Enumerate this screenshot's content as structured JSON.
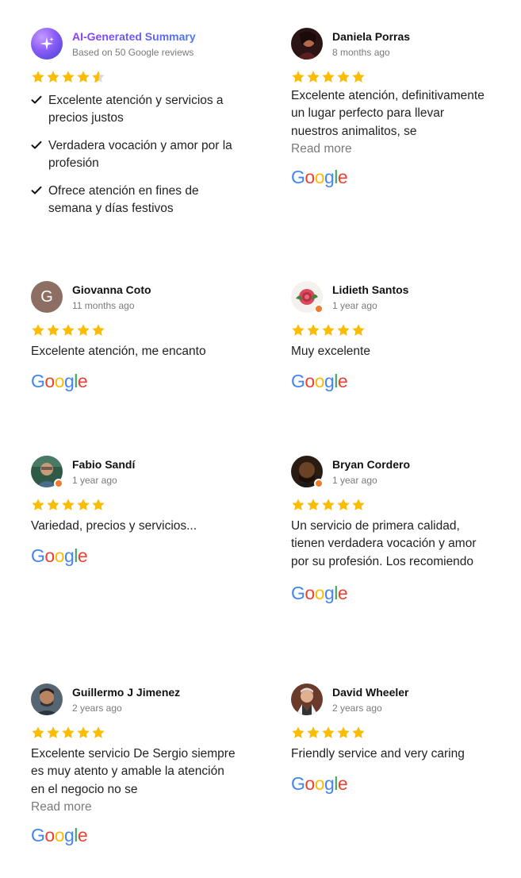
{
  "summary": {
    "title": "AI-Generated Summary",
    "subtitle": "Based on 50 Google reviews",
    "rating": 4.8,
    "points": [
      "Excelente atención y servicios a precios justos",
      "Verdadera vocación y amor por la profesión",
      "Ofrece atención en fines de semana y días festivos"
    ]
  },
  "reviews": [
    {
      "name": "Daniela Porras",
      "date": "8 months ago",
      "rating": 5,
      "text": "Excelente atención, definitivamente un lugar perfecto para llevar nuestros animalitos, se",
      "read_more": "Read more",
      "avatar_color": "#3a1a1a"
    },
    {
      "name": "Giovanna Coto",
      "date": "11 months ago",
      "rating": 5,
      "text": "Excelente atención, me encanto",
      "avatar_letter": "G",
      "avatar_color": "#8d6e63"
    },
    {
      "name": "Lidieth Santos",
      "date": "1 year ago",
      "rating": 5,
      "text": "Muy excelente",
      "avatar_color": "#d84a5c"
    },
    {
      "name": "Fabio Sandí",
      "date": "1 year ago",
      "rating": 5,
      "text": "Variedad, precios y servicios...",
      "avatar_color": "#4a6b5a"
    },
    {
      "name": "Bryan Cordero",
      "date": "1 year ago",
      "rating": 5,
      "text": "Un servicio de primera calidad, tienen verdadera vocación y amor por su profesión. Los recomiendo",
      "avatar_color": "#5a3a22"
    },
    {
      "name": "Guillermo J Jimenez",
      "date": "2 years ago",
      "rating": 5,
      "text": "Excelente servicio De Sergio siempre es muy atento y amable la atención en el negocio no se",
      "read_more": "Read more",
      "avatar_color": "#4b5a66"
    },
    {
      "name": "David Wheeler",
      "date": "2 years ago",
      "rating": 5,
      "text": "Friendly service and very caring",
      "avatar_color": "#7b4a3a"
    }
  ],
  "colors": {
    "star": "#fbbc05",
    "google_blue": "#4285F4",
    "google_red": "#EA4335",
    "google_yellow": "#FBBC05",
    "google_green": "#34A853"
  },
  "icons": {
    "check": "check-icon",
    "star": "star-icon",
    "sparkle": "sparkle-icon"
  }
}
